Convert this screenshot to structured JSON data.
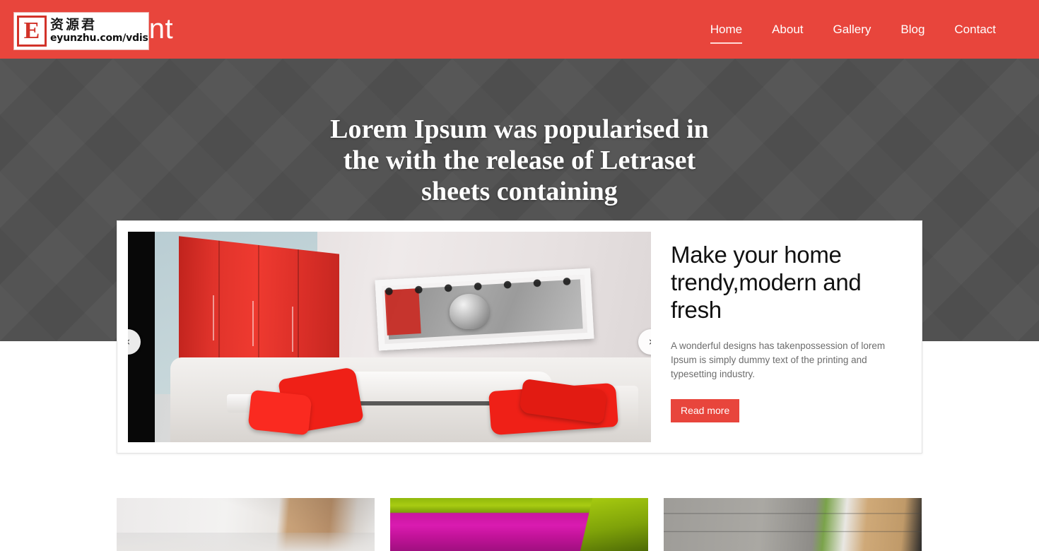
{
  "header": {
    "brand": "Adornment",
    "brand_visible_fragment": "dornment",
    "background_color": "#e8453c",
    "nav": [
      {
        "label": "Home",
        "active": true
      },
      {
        "label": "About",
        "active": false
      },
      {
        "label": "Gallery",
        "active": false
      },
      {
        "label": "Blog",
        "active": false
      },
      {
        "label": "Contact",
        "active": false
      }
    ]
  },
  "watermark": {
    "badge_letter": "E",
    "cn_text": "资源君",
    "url": "eyunzhu.com/vdisk",
    "badge_color": "#d2332a"
  },
  "hero": {
    "title_line1": "Lorem Ipsum was popularised in",
    "title_line2": "the with the release of Letraset",
    "title_line3": "sheets containing",
    "background_color": "#515151"
  },
  "slider": {
    "prev_label": "‹",
    "next_label": "›",
    "slide": {
      "title": "Make your home trendy,modern and fresh",
      "description": "A wonderful designs has takenpossession of lorem Ipsum is simply dummy text of the printing and typesetting industry.",
      "button_label": "Read more",
      "button_color": "#e8453c",
      "image_alt": "Modern living room with red wardrobe, white sofa and red cushions"
    }
  },
  "thumbnails": [
    {
      "alt": "White ceiling and wood panel interior"
    },
    {
      "alt": "Magenta sofa with green wall interior"
    },
    {
      "alt": "Grey wall with window and wooden cabinet"
    }
  ]
}
